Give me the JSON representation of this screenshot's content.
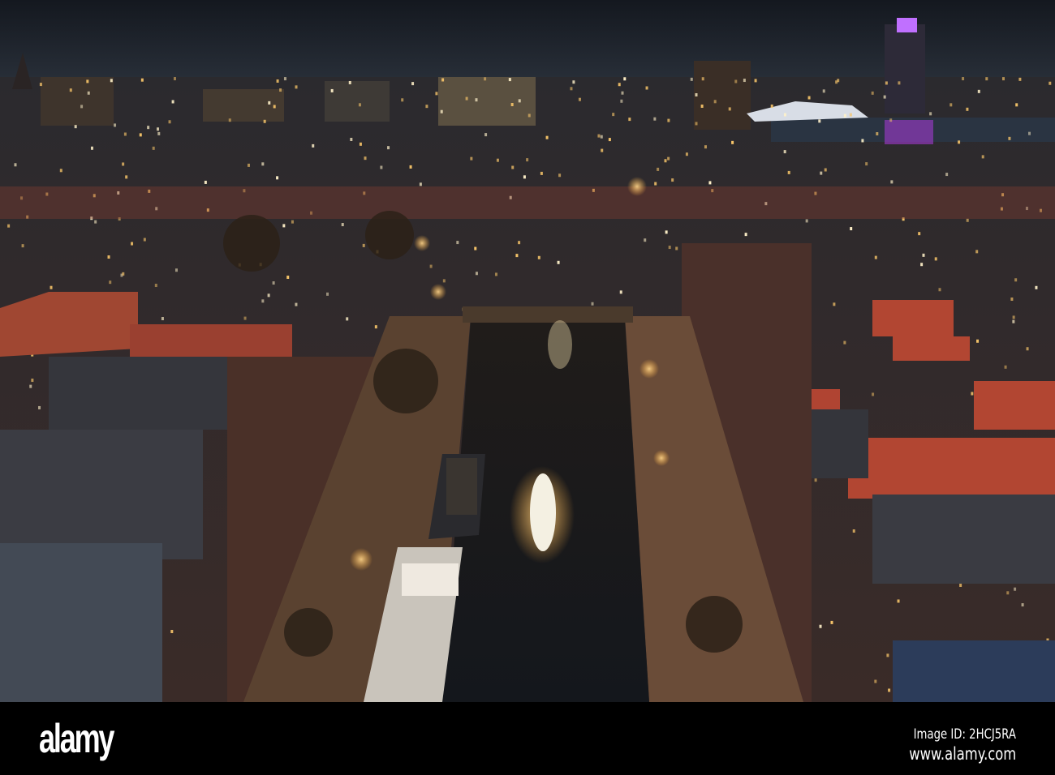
{
  "watermark": {
    "logo": "alamy",
    "image_id": "Image ID: 2HCJ5RA",
    "url": "www.alamy.com"
  },
  "colors": {
    "sky": "#1d232c",
    "water": "#15181d",
    "roof_red": "#b24632",
    "light": "#f7c56a"
  }
}
